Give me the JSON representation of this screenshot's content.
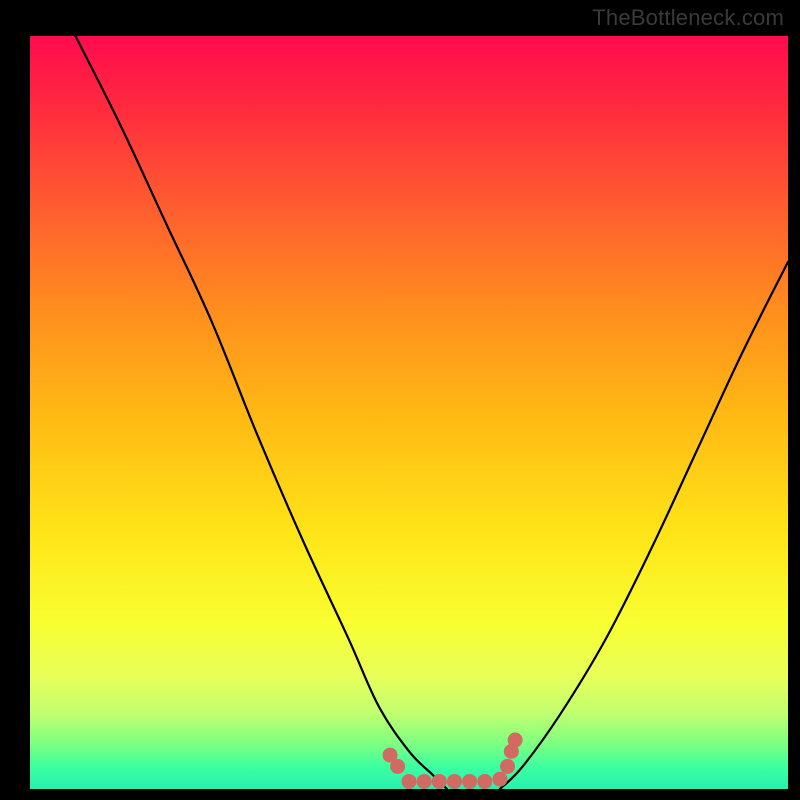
{
  "watermark": "TheBottleneck.com",
  "frame": {
    "outer_size": 800,
    "border_left": 30,
    "border_right": 12,
    "border_top": 36,
    "border_bottom": 11
  },
  "colors": {
    "curve": "#000000",
    "dots": "#d06a62",
    "frame": "#000000"
  },
  "chart_data": {
    "type": "line",
    "title": "",
    "xlabel": "",
    "ylabel": "",
    "xlim": [
      0,
      100
    ],
    "ylim": [
      0,
      100
    ],
    "series": [
      {
        "name": "left-curve",
        "x": [
          6,
          12,
          18,
          24,
          30,
          36,
          42,
          46,
          50,
          53,
          55
        ],
        "y": [
          100,
          88,
          75,
          62,
          47,
          33,
          20,
          11,
          5,
          2,
          0
        ]
      },
      {
        "name": "right-curve",
        "x": [
          62,
          65,
          70,
          76,
          82,
          88,
          94,
          100
        ],
        "y": [
          0,
          3,
          10,
          20,
          32,
          45,
          58,
          70
        ]
      }
    ],
    "dots": {
      "name": "highlight-points",
      "points": [
        {
          "x": 47.5,
          "y": 4.5
        },
        {
          "x": 48.5,
          "y": 3.0
        },
        {
          "x": 50.0,
          "y": 1.0
        },
        {
          "x": 52.0,
          "y": 1.0
        },
        {
          "x": 54.0,
          "y": 1.0
        },
        {
          "x": 56.0,
          "y": 1.0
        },
        {
          "x": 58.0,
          "y": 1.0
        },
        {
          "x": 60.0,
          "y": 1.0
        },
        {
          "x": 62.0,
          "y": 1.3
        },
        {
          "x": 63.0,
          "y": 3.0
        },
        {
          "x": 63.5,
          "y": 5.0
        },
        {
          "x": 64.0,
          "y": 6.5
        }
      ]
    },
    "gradient_stops": [
      {
        "pct": 0,
        "color": "#ff0b50"
      },
      {
        "pct": 22,
        "color": "#ff5a30"
      },
      {
        "pct": 50,
        "color": "#ffb814"
      },
      {
        "pct": 78,
        "color": "#f8ff30"
      },
      {
        "pct": 94,
        "color": "#7dff80"
      },
      {
        "pct": 100,
        "color": "#25f0b0"
      }
    ]
  }
}
